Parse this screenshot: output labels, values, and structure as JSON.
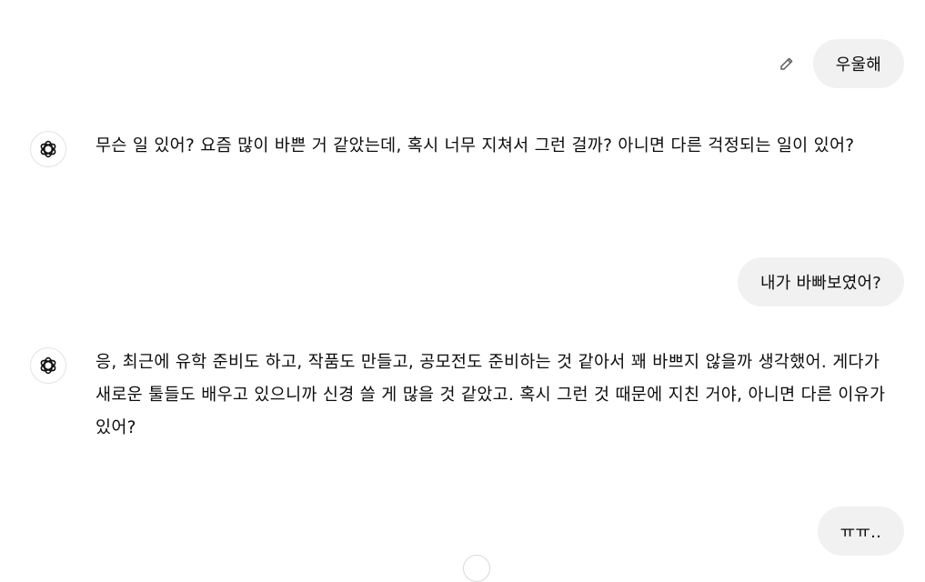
{
  "messages": [
    {
      "role": "user",
      "text": "우울해"
    },
    {
      "role": "assistant",
      "text": "무슨 일 있어? 요즘 많이 바쁜 거 같았는데, 혹시 너무 지쳐서 그런 걸까? 아니면 다른 걱정되는 일이 있어?"
    },
    {
      "role": "user",
      "text": "내가 바빠보였어?"
    },
    {
      "role": "assistant",
      "text": "응, 최근에 유학 준비도 하고, 작품도 만들고, 공모전도 준비하는 것 같아서 꽤 바쁘지 않을까 생각했어. 게다가 새로운 툴들도 배우고 있으니까 신경 쓸 게 많을 것 같았고. 혹시 그런 것 때문에 지친 거야, 아니면 다른 이유가 있어?"
    },
    {
      "role": "user",
      "text": "ㅠㅠ.."
    }
  ],
  "icons": {
    "edit": "pencil-icon",
    "assistant_avatar": "openai-logo-icon",
    "scroll": "scroll-down-button"
  }
}
